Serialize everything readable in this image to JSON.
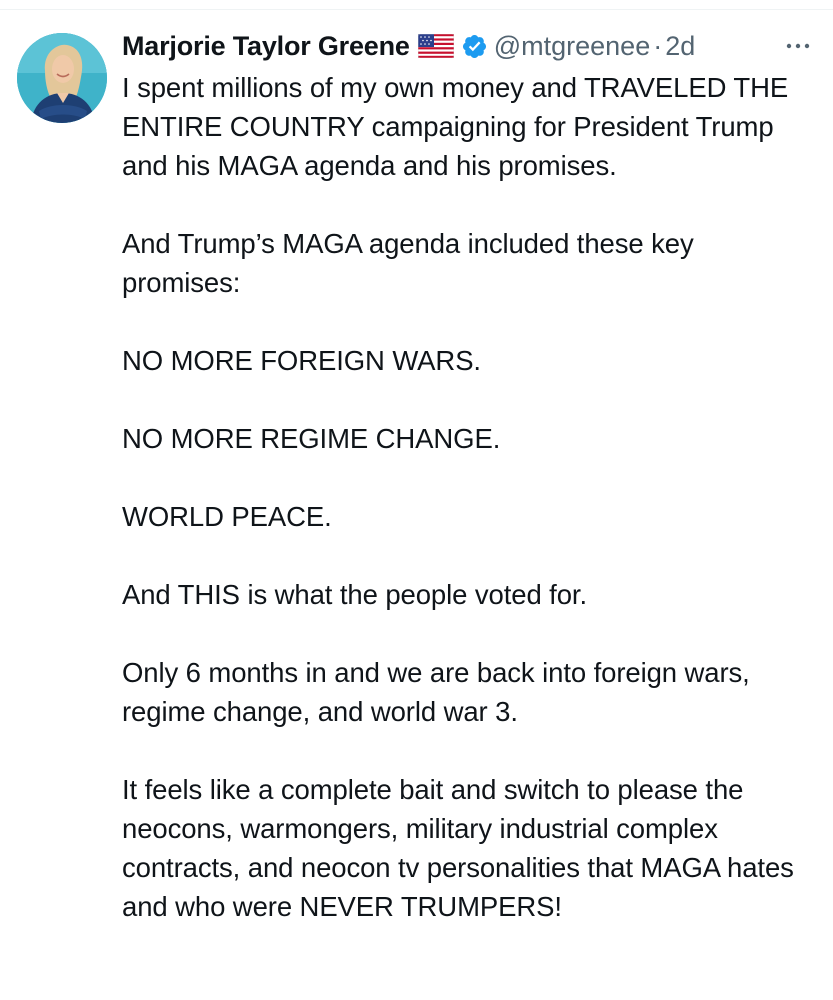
{
  "tweet": {
    "author": {
      "display_name": "Marjorie Taylor Greene",
      "flag_icon": "us-flag-icon",
      "verified_icon": "verified-badge-icon",
      "verified_color": "#1d9bf0",
      "handle": "@mtgreenee",
      "separator": "·",
      "timestamp": "2d"
    },
    "more_icon": "more-options-icon",
    "paragraphs": [
      "I spent millions of my own money and TRAVELED THE ENTIRE COUNTRY campaigning for President Trump and his MAGA agenda and his promises.",
      "And Trump’s MAGA agenda included these key promises:",
      "NO MORE FOREIGN WARS.",
      "NO MORE REGIME CHANGE.",
      "WORLD PEACE.",
      "And THIS is what the people voted for.",
      "Only 6 months in and we are back into foreign wars, regime change, and world war 3.",
      "It feels like a complete bait and switch to please the neocons, warmongers, military industrial complex contracts, and neocon tv personalities that MAGA hates and who were NEVER TRUMPERS!"
    ]
  }
}
